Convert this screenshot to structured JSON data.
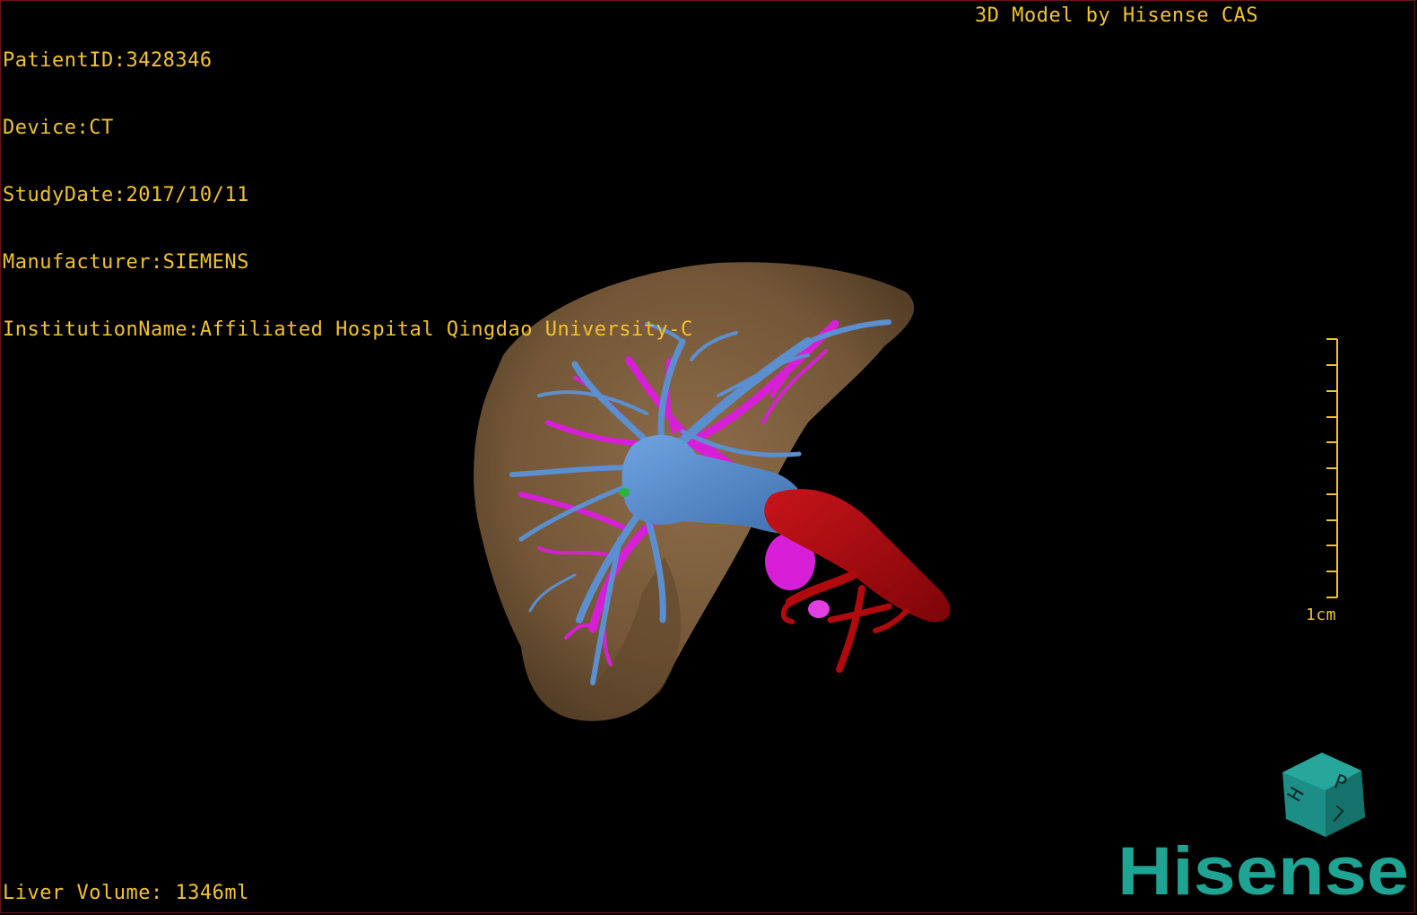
{
  "info": {
    "patient_id": "PatientID:3428346",
    "device": "Device:CT",
    "study_date": "StudyDate:2017/10/11",
    "manufacturer": "Manufacturer:SIEMENS",
    "institution": "InstitutionName:Affiliated Hospital Qingdao University-C"
  },
  "header": {
    "model_credit": "3D Model by Hisense CAS"
  },
  "footer": {
    "liver_volume": "Liver Volume: 1346ml"
  },
  "scale": {
    "label": "1cm"
  },
  "orientation_cube": {
    "faces": [
      "P",
      "H",
      "L"
    ]
  },
  "brand": {
    "logo_text": "Hisense"
  },
  "colors": {
    "overlay_text": "#f2c32a",
    "liver": "#8b6a45",
    "portal_vein": "#5b8fd0",
    "hepatic_vein": "#d81fd8",
    "artery": "#b0090e",
    "cube": "#1d8e86",
    "brand": "#1fa393"
  }
}
